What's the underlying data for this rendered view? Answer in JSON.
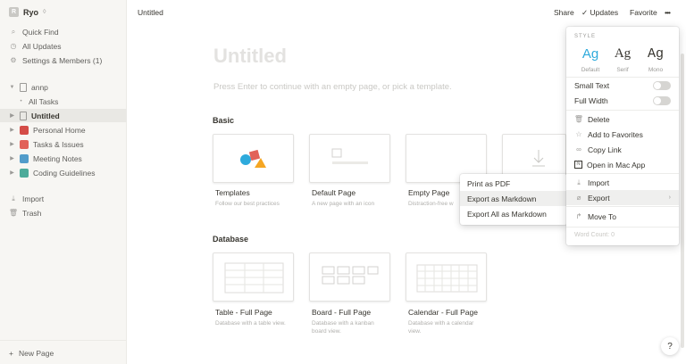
{
  "sidebar": {
    "workspace": {
      "initial": "R",
      "name": "Ryo",
      "caret": "◊"
    },
    "quick": [
      {
        "icon": "search-icon",
        "label": "Quick Find"
      },
      {
        "icon": "clock-icon",
        "label": "All Updates"
      },
      {
        "icon": "gear-icon",
        "label": "Settings & Members (1)"
      }
    ],
    "pages": [
      {
        "label": "annp"
      },
      {
        "label": "All Tasks"
      },
      {
        "label": "Untitled"
      },
      {
        "label": "Personal Home"
      },
      {
        "label": "Tasks & Issues"
      },
      {
        "label": "Meeting Notes"
      },
      {
        "label": "Coding Guidelines"
      }
    ],
    "import_label": "Import",
    "trash_label": "Trash",
    "new_page_label": "New Page"
  },
  "topbar": {
    "breadcrumb": "Untitled",
    "share": "Share",
    "updates": "Updates",
    "favorite": "Favorite",
    "more": "•••"
  },
  "main": {
    "title_placeholder": "Untitled",
    "hint": "Press Enter to continue with an empty page, or pick a template.",
    "basic_label": "Basic",
    "database_label": "Database",
    "basic_cards": [
      {
        "title": "Templates",
        "desc": "Follow our best practices"
      },
      {
        "title": "Default Page",
        "desc": "A new page with an icon"
      },
      {
        "title": "Empty Page",
        "desc": "Distraction-free w"
      }
    ],
    "db_cards": [
      {
        "title": "Table - Full Page",
        "desc": "Database with a table view."
      },
      {
        "title": "Board - Full Page",
        "desc": "Database with a kanban board view."
      },
      {
        "title": "Calendar - Full Page",
        "desc": "Database with a calendar view."
      }
    ]
  },
  "menu": {
    "style_header": "STYLE",
    "fonts": [
      {
        "glyph": "Ag",
        "label": "Default"
      },
      {
        "glyph": "Ag",
        "label": "Serif"
      },
      {
        "glyph": "Ag",
        "label": "Mono"
      }
    ],
    "small_text": "Small Text",
    "full_width": "Full Width",
    "delete": "Delete",
    "add_favorites": "Add to Favorites",
    "copy_link": "Copy Link",
    "open_mac": "Open in Mac App",
    "import": "Import",
    "export": "Export",
    "move_to": "Move To",
    "word_count": "Word Count: 0"
  },
  "export_submenu": {
    "pdf": "Print as PDF",
    "markdown": "Export as Markdown",
    "all_markdown": "Export All as Markdown"
  },
  "help": "?",
  "colors": {
    "accent": "#2eaadc",
    "sidebar_bg": "#f7f6f3",
    "text": "#37352f"
  }
}
